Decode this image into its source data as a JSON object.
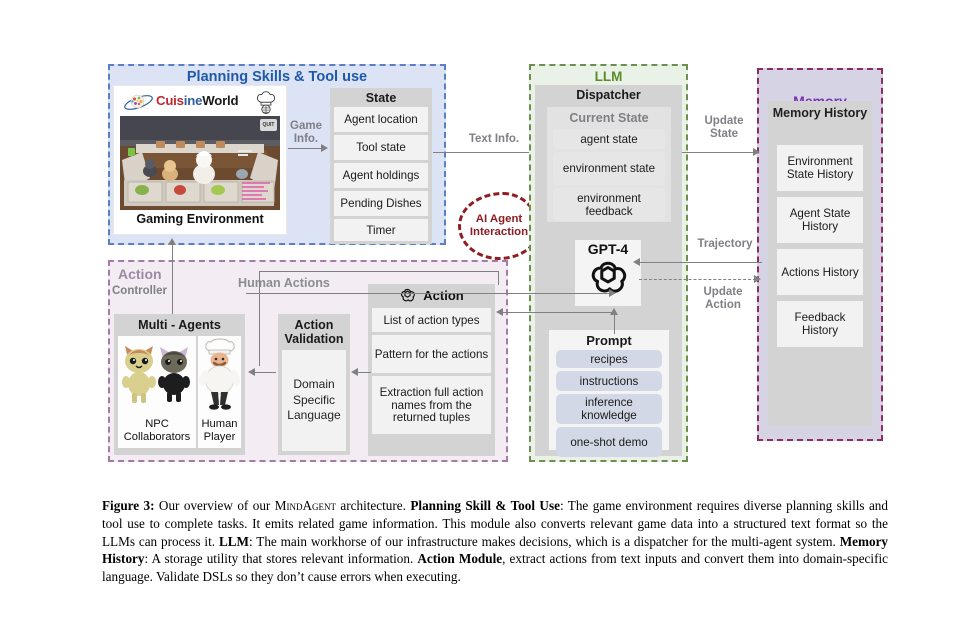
{
  "sections": {
    "planning": {
      "title": "Planning Skills & Tool use",
      "game_caption": "Gaming Environment",
      "logo": {
        "part1": "Cuis",
        "part2": "ine",
        "part3": "World"
      },
      "quit_badge": "QUIT",
      "state": {
        "title": "State",
        "items": [
          "Agent location",
          "Tool state",
          "Agent holdings",
          "Pending Dishes",
          "Timer"
        ]
      }
    },
    "llm": {
      "title": "LLM",
      "dispatcher_title": "Dispatcher",
      "current_state": {
        "title": "Current State",
        "items": [
          "agent state",
          "environment state",
          "environment feedback"
        ]
      },
      "model": "GPT-4",
      "prompt": {
        "title": "Prompt",
        "items": [
          "recipes",
          "instructions",
          "inference knowledge",
          "one-shot demo"
        ]
      }
    },
    "memory": {
      "title": "Memory",
      "history_title": "Memory History",
      "items": [
        "Environment State History",
        "Agent State History",
        "Actions History",
        "Feedback History"
      ]
    },
    "action": {
      "title": "Action",
      "controller_label": "Controller",
      "human_actions_label": "Human Actions",
      "multi_agents": {
        "title": "Multi - Agents",
        "npc_caption": "NPC Collaborators",
        "human_caption": "Human Player"
      },
      "validation": {
        "title": "Action Validation",
        "dsl": "Domain Specific Language"
      },
      "action_module": {
        "title": "Action",
        "items": [
          "List of action types",
          "Pattern for the actions",
          "Extraction full action names from the returned tuples"
        ]
      }
    }
  },
  "arrows": {
    "game_info": "Game Info.",
    "text_info": "Text Info.",
    "update_state": "Update State",
    "trajectory": "Trajectory",
    "update_action": "Update Action",
    "ai_agent_interaction": "AI Agent Interaction"
  },
  "caption": {
    "label": "Figure 3:",
    "t1": " Our overview of our ",
    "name": "MindAgent",
    "t2": " architecture. ",
    "b1": "Planning Skill & Tool Use",
    "t3": ": The game environment requires diverse planning skills and tool use to complete tasks. It emits related game information. This module also converts relevant game data into a structured text format so the LLMs can process it. ",
    "b2": "LLM",
    "t4": ": The main workhorse of our infrastructure makes decisions, which is a dispatcher for the multi-agent system. ",
    "b3": "Memory History",
    "t5": ": A storage utility that stores relevant information. ",
    "b4": "Action Module",
    "t6": ", extract actions from text inputs and convert them into domain-specific language. Validate DSLs so they don’t cause errors when executing."
  },
  "colors": {
    "planning_border": "#5b7fc4",
    "planning_fill": "#dbe3f5",
    "llm_border": "#6c8f4e",
    "llm_fill": "#eaf1e7",
    "memory_border": "#8d2b63",
    "memory_fill": "#d6d3e5",
    "action_border": "#a579a8",
    "action_fill": "#f3ecf3",
    "accent_red": "#8f1d22",
    "arrow_gray": "#808080"
  }
}
